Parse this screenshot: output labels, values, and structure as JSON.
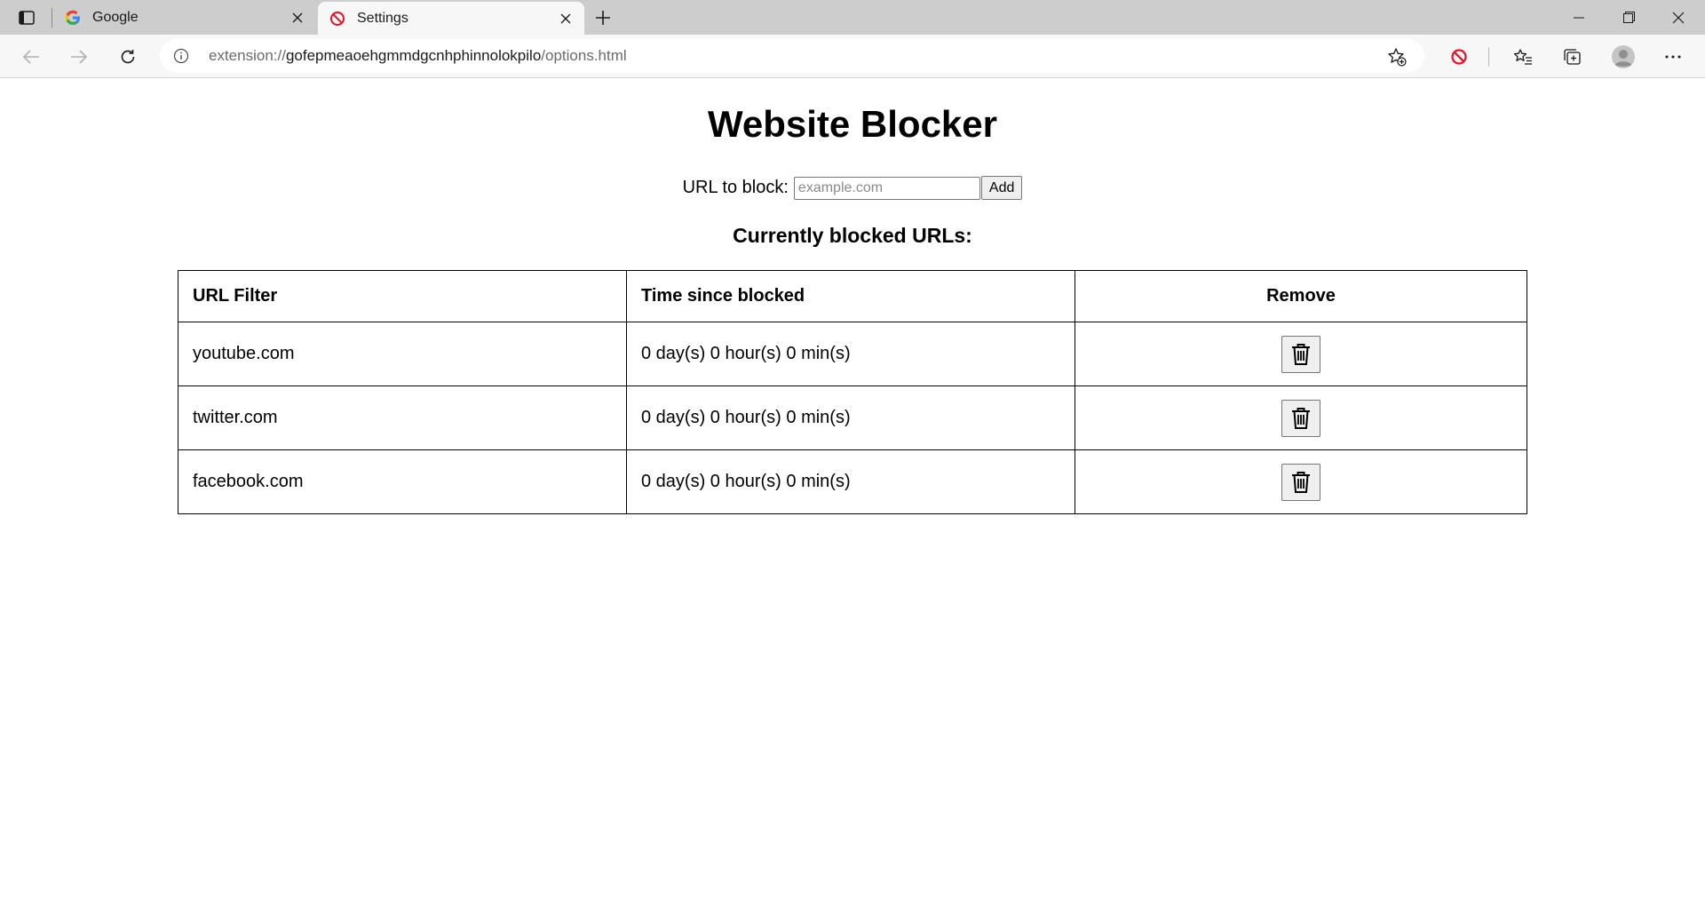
{
  "browser": {
    "tabs": [
      {
        "title": "Google",
        "favicon": "google-g-icon",
        "active": false
      },
      {
        "title": "Settings",
        "favicon": "block-icon",
        "active": true
      }
    ],
    "address": {
      "scheme": "extension://",
      "host": "gofepmeaoehgmmdgcnhphinnolokpilo",
      "path": "/options.html"
    }
  },
  "page": {
    "title": "Website Blocker",
    "form": {
      "label": "URL to block:",
      "placeholder": "example.com",
      "value": "",
      "add_label": "Add"
    },
    "subtitle": "Currently blocked URLs:",
    "table": {
      "headers": [
        "URL Filter",
        "Time since blocked",
        "Remove"
      ],
      "rows": [
        {
          "url": "youtube.com",
          "time": "0 day(s) 0 hour(s) 0 min(s)"
        },
        {
          "url": "twitter.com",
          "time": "0 day(s) 0 hour(s) 0 min(s)"
        },
        {
          "url": "facebook.com",
          "time": "0 day(s) 0 hour(s) 0 min(s)"
        }
      ]
    }
  },
  "colors": {
    "tabstrip": "#cdcdcd",
    "toolbar": "#f7f7f7",
    "block_red": "#e81123"
  }
}
